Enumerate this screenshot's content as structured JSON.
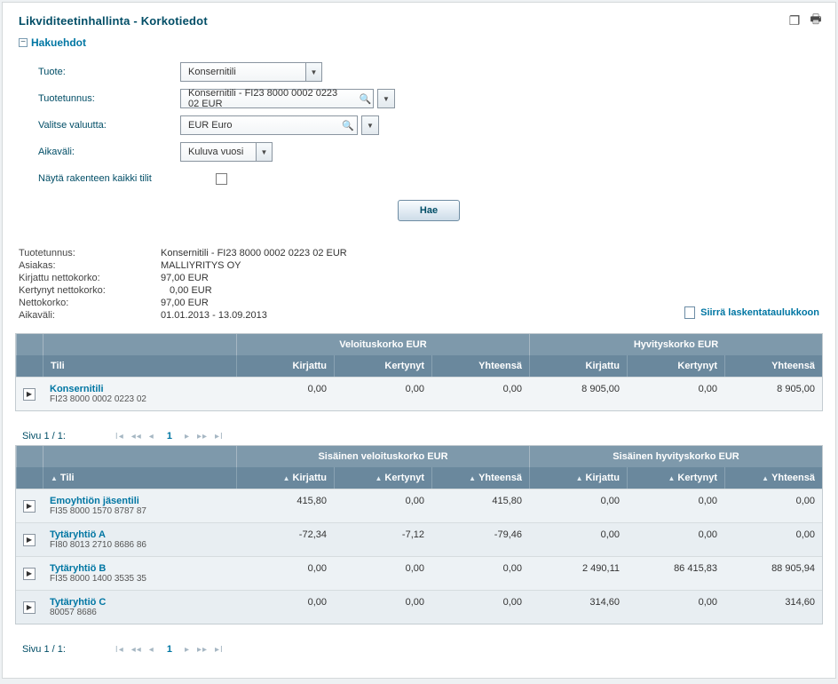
{
  "header": {
    "title": "Likviditeetinhallinta - Korkotiedot"
  },
  "section": {
    "title": "Hakuehdot"
  },
  "form": {
    "product_label": "Tuote:",
    "product_value": "Konsernitili",
    "tunnus_label": "Tuotetunnus:",
    "tunnus_value": "Konsernitili - FI23 8000 0002 0223 02 EUR",
    "currency_label": "Valitse valuutta:",
    "currency_value": "EUR Euro",
    "period_label": "Aikaväli:",
    "period_value": "Kuluva vuosi",
    "showall_label": "Näytä rakenteen kaikki tilit",
    "search_btn": "Hae"
  },
  "summary": {
    "tunnus_label": "Tuotetunnus:",
    "tunnus_value": "Konsernitili - FI23 8000 0002 0223 02 EUR",
    "asiakas_label": "Asiakas:",
    "asiakas_value": "MALLIYRITYS OY",
    "kirjattu_label": "Kirjattu nettokorko:",
    "kirjattu_value": "97,00 EUR",
    "kertynyt_label": "Kertynyt nettokorko:",
    "kertynyt_value": "0,00 EUR",
    "netto_label": "Nettokorko:",
    "netto_value": "97,00 EUR",
    "aikavali_label": "Aikaväli:",
    "aikavali_value": "01.01.2013 - 13.09.2013",
    "export_label": "Siirrä laskentataulukkoon"
  },
  "table1": {
    "group_debit": "Veloituskorko EUR",
    "group_credit": "Hyvityskorko EUR",
    "col_tili": "Tili",
    "col_kirjattu": "Kirjattu",
    "col_kertynyt": "Kertynyt",
    "col_yhteensa": "Yhteensä",
    "row": {
      "name": "Konsernitili",
      "acct": "FI23 8000 0002 0223 02",
      "d_kirjattu": "0,00",
      "d_kertynyt": "0,00",
      "d_yhteensa": "0,00",
      "c_kirjattu": "8 905,00",
      "c_kertynyt": "0,00",
      "c_yhteensa": "8 905,00"
    }
  },
  "pager1": {
    "label": "Sivu 1 / 1:",
    "current": "1"
  },
  "table2": {
    "group_debit": "Sisäinen veloituskorko EUR",
    "group_credit": "Sisäinen hyvityskorko EUR",
    "col_tili": "Tili",
    "col_kirjattu": "Kirjattu",
    "col_kertynyt": "Kertynyt",
    "col_yhteensa": "Yhteensä",
    "rows": [
      {
        "name": "Emoyhtiön jäsentili",
        "acct": "FI35 8000 1570 8787 87",
        "d_kirjattu": "415,80",
        "d_kertynyt": "0,00",
        "d_yhteensa": "415,80",
        "c_kirjattu": "0,00",
        "c_kertynyt": "0,00",
        "c_yhteensa": "0,00"
      },
      {
        "name": "Tytäryhtiö A",
        "acct": "FI80 8013 2710 8686 86",
        "d_kirjattu": "-72,34",
        "d_kertynyt": "-7,12",
        "d_yhteensa": "-79,46",
        "c_kirjattu": "0,00",
        "c_kertynyt": "0,00",
        "c_yhteensa": "0,00"
      },
      {
        "name": "Tytäryhtiö B",
        "acct": "FI35 8000 1400 3535 35",
        "d_kirjattu": "0,00",
        "d_kertynyt": "0,00",
        "d_yhteensa": "0,00",
        "c_kirjattu": "2 490,11",
        "c_kertynyt": "86 415,83",
        "c_yhteensa": "88 905,94"
      },
      {
        "name": "Tytäryhtiö C",
        "acct": "80057 8686",
        "d_kirjattu": "0,00",
        "d_kertynyt": "0,00",
        "d_yhteensa": "0,00",
        "c_kirjattu": "314,60",
        "c_kertynyt": "0,00",
        "c_yhteensa": "314,60"
      }
    ]
  },
  "pager2": {
    "label": "Sivu 1 / 1:",
    "current": "1"
  }
}
